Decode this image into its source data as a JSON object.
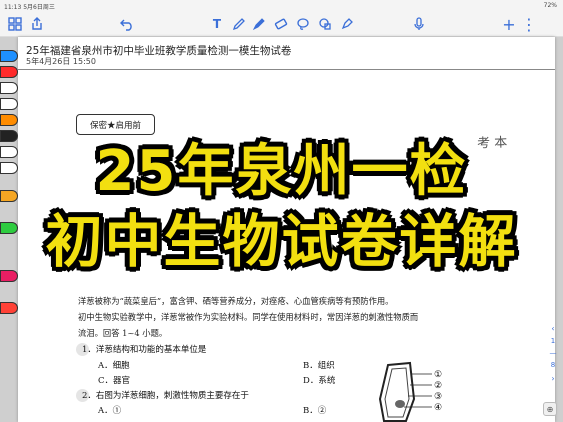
{
  "status": {
    "time": "11:13",
    "date": "5月6日周三",
    "battery": "72%"
  },
  "toolbar": {
    "icons": [
      "grid-icon",
      "share-icon",
      "undo-icon",
      "text-icon",
      "pen-icon",
      "marker-icon",
      "eraser-icon",
      "lasso-icon",
      "shape-icon",
      "highlighter-icon",
      "mic-icon",
      "add-icon",
      "more-icon"
    ]
  },
  "document": {
    "title": "25年福建省泉州市初中毕业班教学质量检测一模生物试卷",
    "date": "5年4月26日 15:50",
    "secret_label": "保密★启用前",
    "corner_text": "考 本",
    "body_lines": [
      "洋葱被称为“蔬菜皇后”，富含钾、硒等营养成分，对痤疮、心血管疾病等有预防作用。",
      "初中生物实验教学中，洋葱常被作为实验材料。同学在使用材料时，常因洋葱的刺激性物质而",
      "流泪。回答 1~4 小题。"
    ],
    "questions": [
      {
        "stem": "1．洋葱结构和功能的基本单位是",
        "options": [
          "A．细胞",
          "B．组织",
          "C．器官",
          "D．系统"
        ]
      },
      {
        "stem": "2．右图为洋葱细胞，刺激性物质主要存在于",
        "options": [
          "A．①",
          "B．②"
        ]
      }
    ],
    "figure_labels": [
      "①",
      "②",
      "③",
      "④"
    ]
  },
  "overlay": {
    "line1": "25年泉州一检",
    "line2": "初中生物试卷详解"
  },
  "palette": {
    "colors": [
      "#1e90ff",
      "#ff2a2a",
      "#ffffff",
      "#ffffff",
      "#ff8c00",
      "#222222",
      "#ffffff",
      "#ffffff",
      "#f5a623",
      "#2ecc40",
      "#e91e63",
      "#ff4136"
    ]
  },
  "side": {
    "page_current": "1",
    "page_total": "8",
    "zoom_icon": "zoom-icon"
  }
}
